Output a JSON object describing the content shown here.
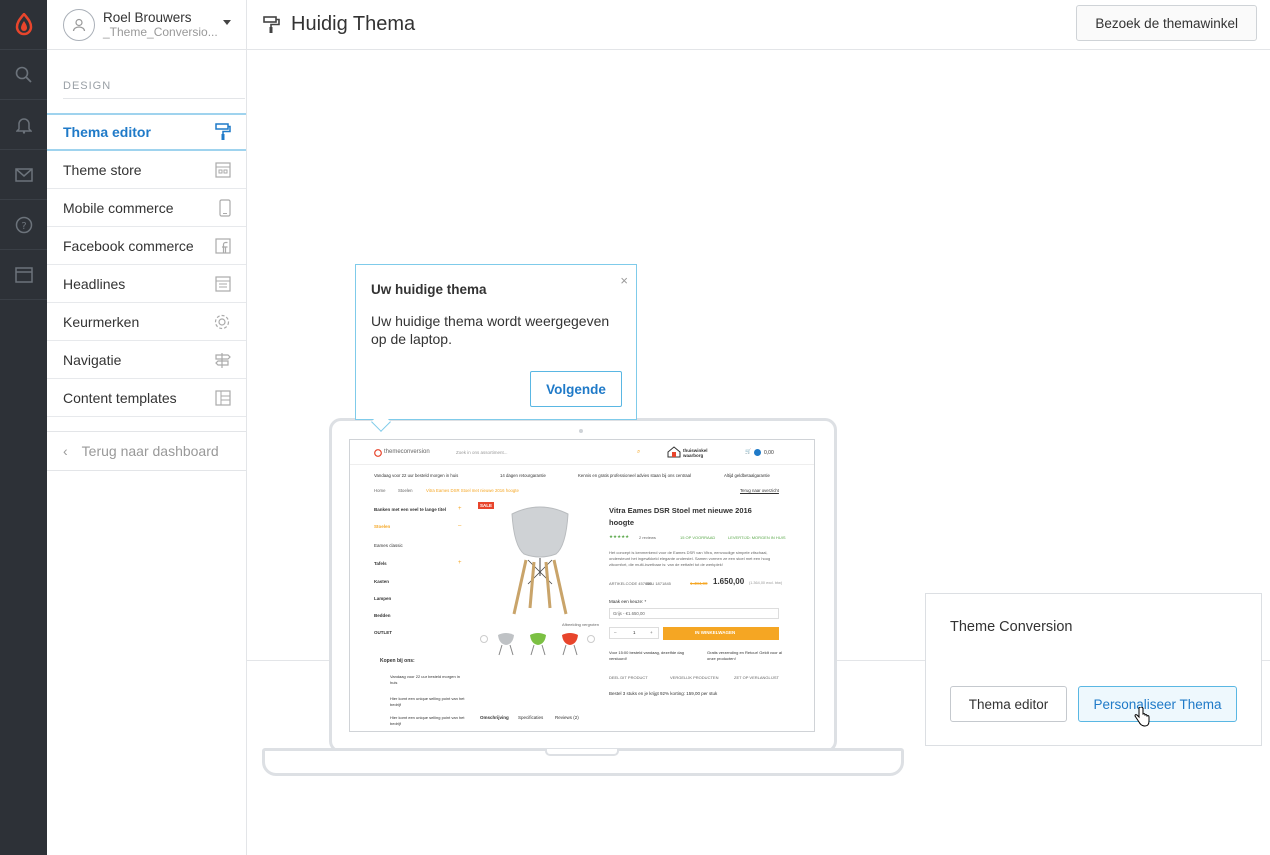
{
  "user": {
    "name": "Roel Brouwers",
    "shop": "_Theme_Conversio..."
  },
  "header": {
    "title": "Huidig Thema",
    "visit_button": "Bezoek de themawinkel"
  },
  "sidebar": {
    "section_title": "DESIGN",
    "items": [
      {
        "label": "Thema editor",
        "icon": "paint-roller-icon",
        "active": true
      },
      {
        "label": "Theme store",
        "icon": "store-icon",
        "active": false
      },
      {
        "label": "Mobile commerce",
        "icon": "mobile-icon",
        "active": false
      },
      {
        "label": "Facebook commerce",
        "icon": "facebook-icon",
        "active": false
      },
      {
        "label": "Headlines",
        "icon": "headlines-icon",
        "active": false
      },
      {
        "label": "Keurmerken",
        "icon": "badge-icon",
        "active": false
      },
      {
        "label": "Navigatie",
        "icon": "signpost-icon",
        "active": false
      },
      {
        "label": "Content templates",
        "icon": "template-icon",
        "active": false
      }
    ],
    "back_label": "Terug naar dashboard"
  },
  "rail": [
    "logo-icon",
    "search-icon",
    "bell-icon",
    "mail-icon",
    "help-icon",
    "window-icon"
  ],
  "tooltip": {
    "title": "Uw huidige thema",
    "body": "Uw huidige thema wordt weergegeven op de laptop.",
    "next_button": "Volgende",
    "close": "×"
  },
  "preview": {
    "logo": "themeconversion",
    "search_placeholder": "Zoek in ons assortiment...",
    "brand_badge": "thuiswinkel waarborg",
    "cart_total": "0,00",
    "usps": [
      "Vandaag voor 22 uur besteld morgen in huis",
      "14 dagen retourgarantie",
      "Kennis en gratis professioneel advies staan bij ons centraal",
      "Altijd geldbetaalgarantie"
    ],
    "breadcrumb": [
      "Home",
      "Stoelen",
      "Vitra Eames DSR Stoel met nieuwe 2016 hoogte"
    ],
    "back_link": "Terug naar overzicht",
    "categories": [
      "Banken met een veel te lange titel",
      "Stoelen",
      "Eames classic",
      "Tafels",
      "Kasten",
      "Lampen",
      "Bedden",
      "OUTLET"
    ],
    "sale": "SALE",
    "product_title": "Vitra Eames DSR Stoel met nieuwe 2016 hoogte",
    "reviews": "2 reviews",
    "stock": "15 OP VOORRAAD",
    "delivery": "LEVERTIJD: MORGEN IN HUIS",
    "old_price": "1.484,00",
    "price": "1.650,00",
    "price_note": "(1.364,00 excl. btw)",
    "article": "ARTIKELCODE 457683",
    "sku": "SKU 1871845",
    "option_label": "Maak een keuze: *",
    "option_value": "Grijs - €1.650,00",
    "qty": "1",
    "cart_button": "IN WINKELWAGEN",
    "why_title": "Kopen bij ons:",
    "why": [
      "Vandaag voor 22 uur besteld morgen in huis",
      "Hier komt een unique selling point van het bedrijf",
      "Hier komt een unique selling point van het bedrijf"
    ],
    "tabs": [
      "Omschrijving",
      "Specificaties",
      "Reviews (2)"
    ],
    "discount": "Bestel 3 stuks en je krijgt 92% korting: 159,00 per stuk",
    "image_caption": "Afbeelding vergroten",
    "description": "Het concept is kenmerkend voor de Eames DSR van Vitra, eenvoudige simpele zitschaal, ondersteunt het ingewikkeld elegante onderstel. Samen vormen ze een stoel met een hoog zitcomfort, die multi-inzetbaar is: van de eettafel tot de werkplek!",
    "delivery_notes": [
      "Voor 15:00 besteld vandaag, dezelfde dag verstuurd!",
      "Gratis verzending en Retour! Geldt voor al onze producten!"
    ],
    "actions": [
      "DEEL DIT PRODUCT",
      "VERGELIJK PRODUCTEN",
      "ZET OP VERLANGLIJST"
    ]
  },
  "card": {
    "theme_name": "Theme Conversion",
    "editor_button": "Thema editor",
    "customize_button": "Personaliseer Thema"
  },
  "colors": {
    "rail": "#2d3137",
    "accent": "#1f7ac8",
    "highlight": "#9fd3ee",
    "brand_orange": "#f5a623",
    "logo_red": "#e8452c"
  }
}
